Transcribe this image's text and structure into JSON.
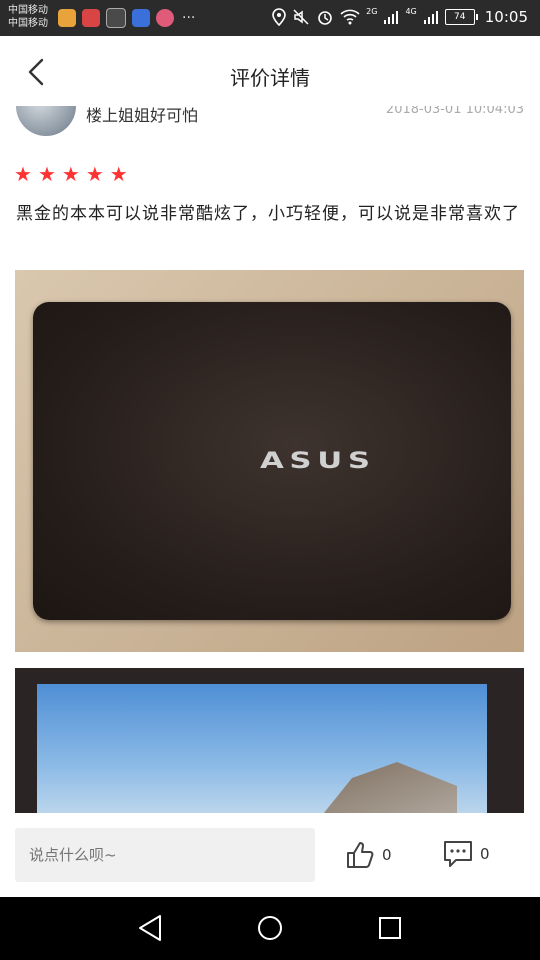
{
  "status_bar": {
    "carrier_1": "中国移动",
    "carrier_2": "中国移动",
    "network_2": "2G",
    "network_4": "4G",
    "battery": "74",
    "time": "10:05"
  },
  "header": {
    "title": "评价详情"
  },
  "review": {
    "user_name": "楼上姐姐好可怕",
    "date": "2018-03-01 10:04:03",
    "rating": 5,
    "text": "黑金的本本可以说非常酷炫了，小巧轻便，可以说是非常喜欢了",
    "brand_logo": "ASUS"
  },
  "bottom_bar": {
    "input_placeholder": "说点什么呗~",
    "like_count": "0",
    "comment_count": "0"
  },
  "colors": {
    "star": "#ff3333",
    "status_bar": "#2b2b2b"
  }
}
